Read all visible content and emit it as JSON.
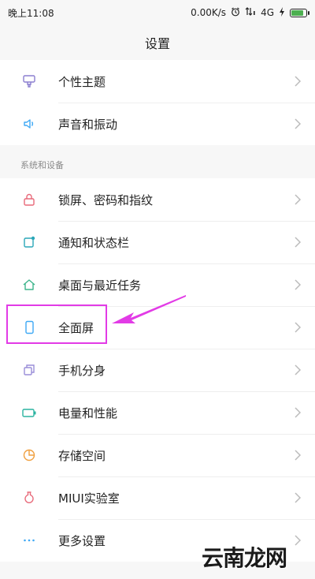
{
  "status_bar": {
    "time": "晚上11:08",
    "network_speed": "0.00K/s",
    "network_type": "4G",
    "icons": [
      "alarm-icon",
      "signal-icon",
      "charging-icon",
      "battery-icon"
    ],
    "battery_level": 0.85,
    "battery_color": "#4caf50"
  },
  "header": {
    "title": "设置"
  },
  "group1": {
    "items": [
      {
        "label": "个性主题",
        "icon": "theme-icon"
      },
      {
        "label": "声音和振动",
        "icon": "speaker-icon"
      }
    ]
  },
  "section": {
    "label": "系统和设备"
  },
  "group2": {
    "items": [
      {
        "label": "锁屏、密码和指纹",
        "icon": "lock-icon"
      },
      {
        "label": "通知和状态栏",
        "icon": "notification-icon"
      },
      {
        "label": "桌面与最近任务",
        "icon": "home-icon"
      },
      {
        "label": "全面屏",
        "icon": "phone-icon"
      },
      {
        "label": "手机分身",
        "icon": "copy-icon"
      },
      {
        "label": "电量和性能",
        "icon": "battery-icon"
      },
      {
        "label": "存储空间",
        "icon": "storage-icon"
      },
      {
        "label": "MIUI实验室",
        "icon": "flask-icon"
      },
      {
        "label": "更多设置",
        "icon": "more-icon"
      }
    ]
  },
  "annotation": {
    "highlight_color": "#e23be6"
  },
  "watermark": {
    "text": "云南龙网"
  }
}
